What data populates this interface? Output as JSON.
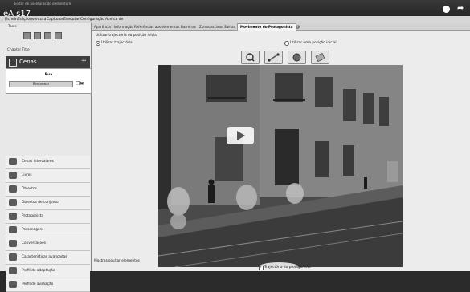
{
  "video": {
    "title": "eA s17",
    "subtitle": "Editor de aventuras do eAdventure"
  },
  "menubar": {
    "items": [
      "Ficheiro",
      "Edição",
      "Aventura",
      "Capítulos",
      "Executar",
      "Configuração",
      "Acerca de"
    ]
  },
  "left_panel": {
    "tools_label": "Tools",
    "chapter_label": "Chapter Title",
    "scenes": {
      "title": "Cenas",
      "add_symbol": "+",
      "current_scene": "Rua",
      "rename_label": "Renomear"
    },
    "nav_items": [
      "Cenas intercalares",
      "Livros",
      "Objectos",
      "Objectos de conjunto",
      "Protagonista",
      "Personagens",
      "Conversações",
      "Características avançadas",
      "Perfil de adaptação",
      "Perfil de avaliação"
    ]
  },
  "tabs": {
    "items": [
      "Aparência",
      "Informação",
      "Referências aos elementos",
      "Barreiras",
      "Zonas activas",
      "Saídas",
      "Movimento do Protagonista"
    ],
    "active_index": 6
  },
  "movement": {
    "use_trajectory_section": "Utilizar trajectória ou posição inicial",
    "use_trajectory": "Utilizar trajectória",
    "use_initial_position": "Utilizar uma posição inicial",
    "selected": "use_trajectory"
  },
  "toolbar_icons": [
    "zoom-icon",
    "draw-path-icon",
    "node-icon",
    "eraser-icon"
  ],
  "bottom": {
    "show_hide_label": "Mostrar/ocultar elementos",
    "protagonist_trajectory_label": "Trajectória do protagonista",
    "protagonist_trajectory_checked": true
  },
  "colors": {
    "topbar": "#2b2b2b",
    "panel": "#e8e8e8",
    "header": "#3d3d3d"
  }
}
